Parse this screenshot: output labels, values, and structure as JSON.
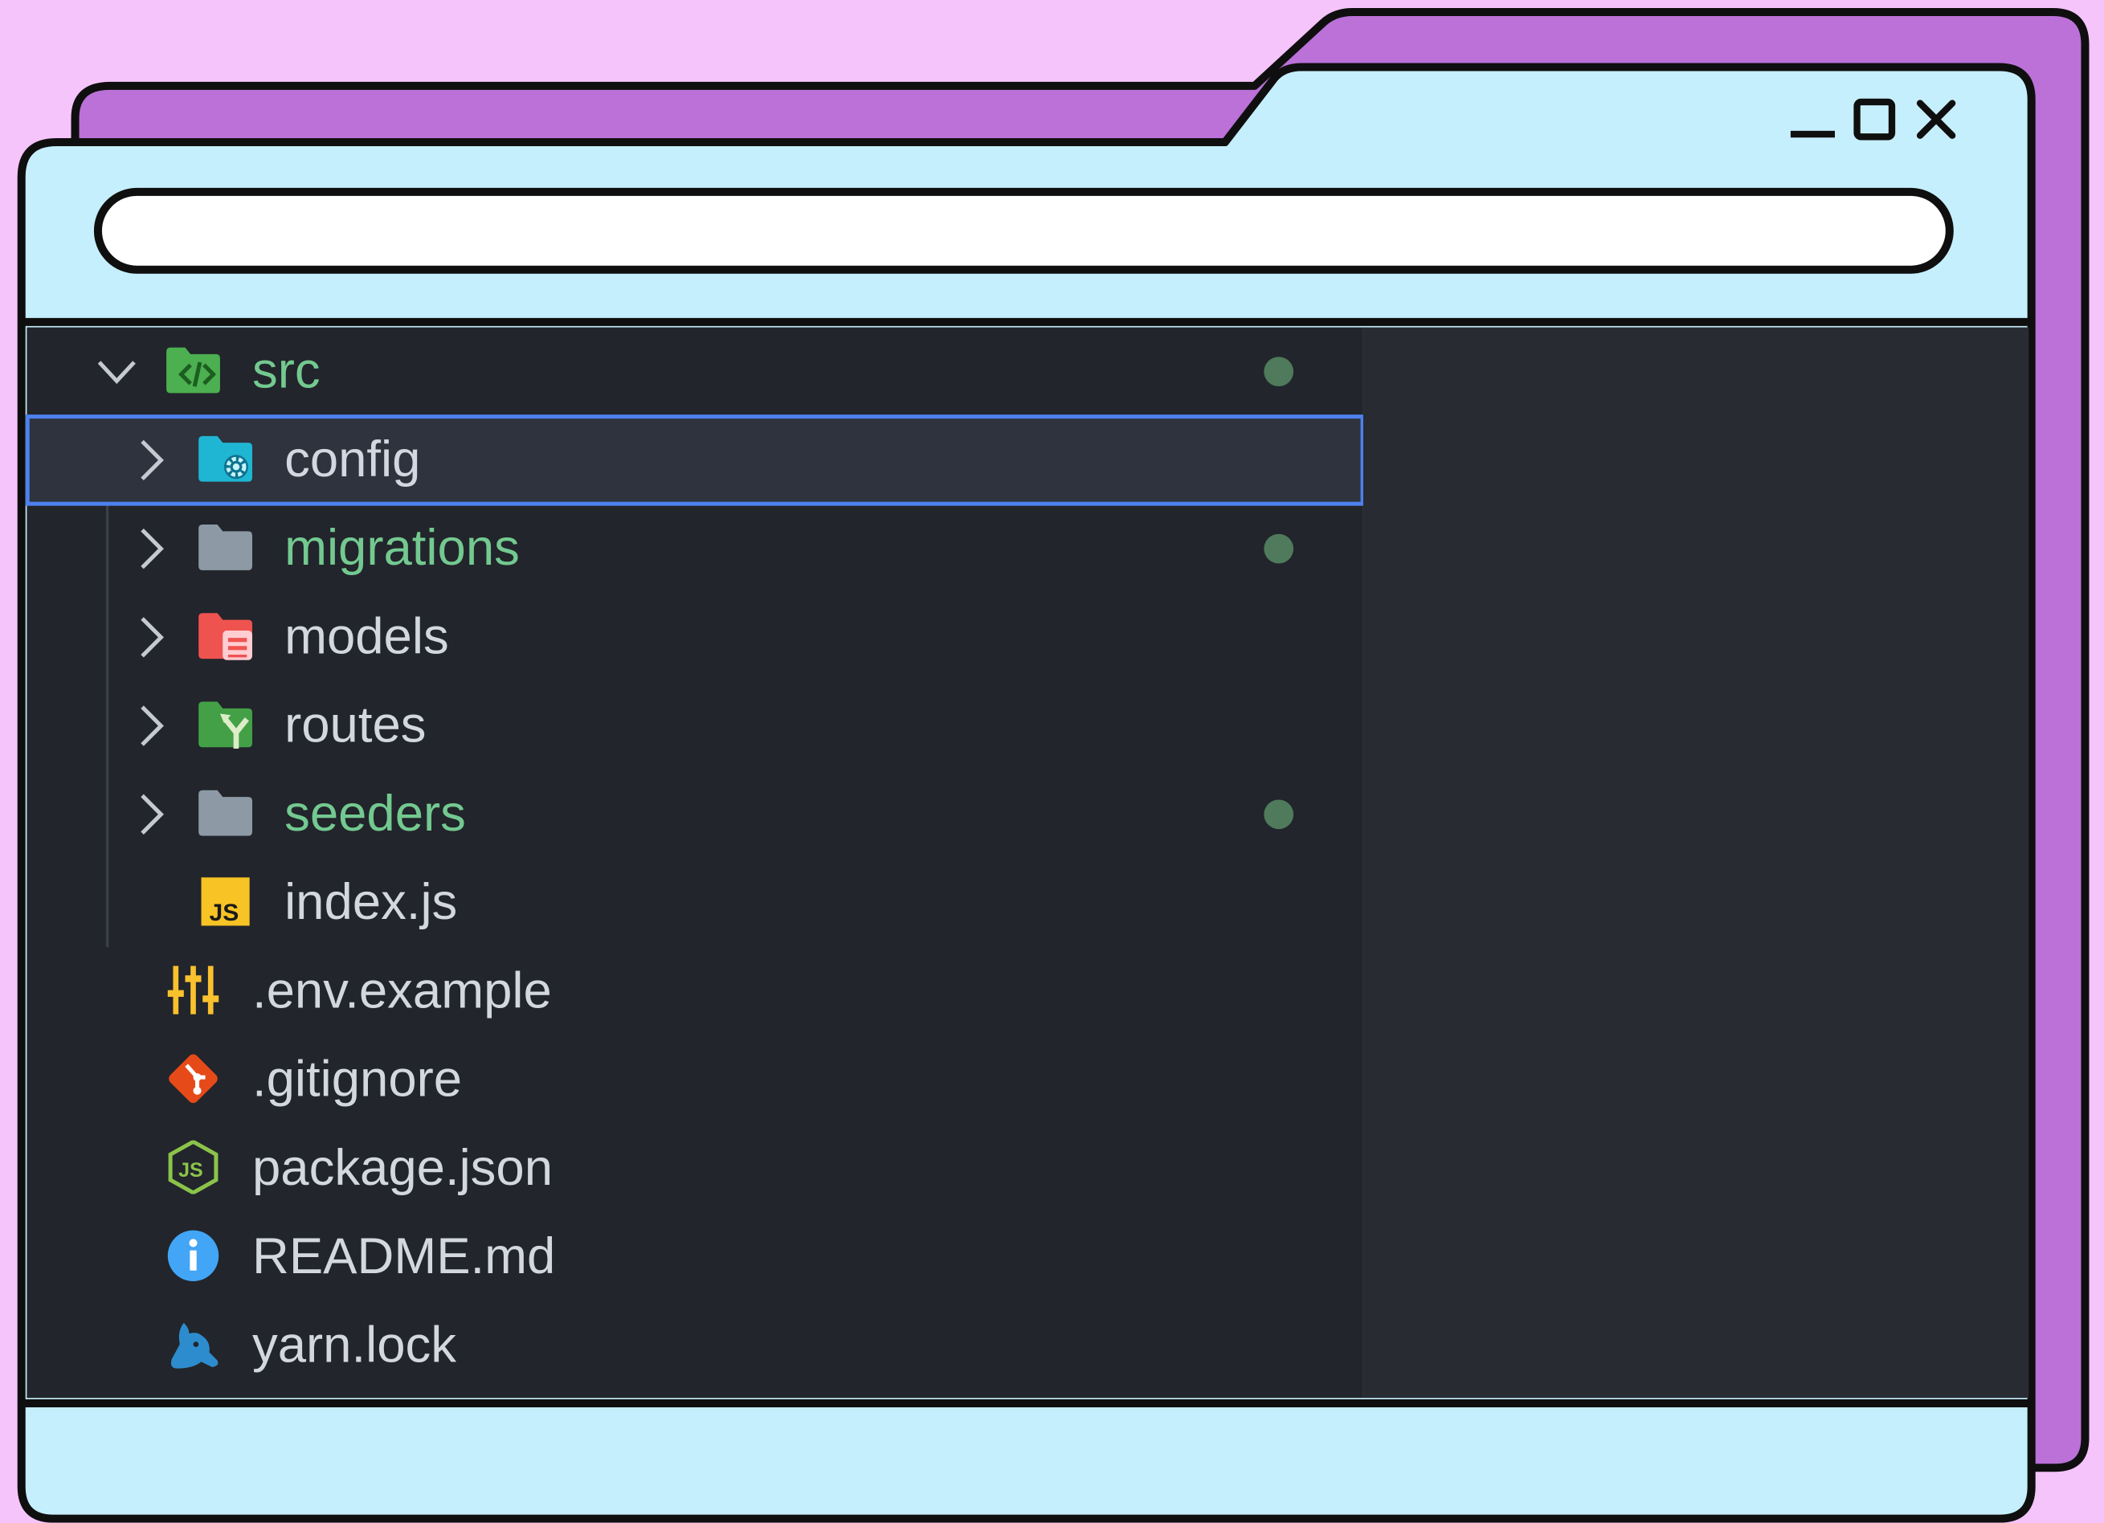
{
  "window": {
    "address_value": "",
    "controls": [
      "minimize-icon",
      "maximize-icon",
      "close-icon"
    ],
    "colors": {
      "backdrop": "#f5c4fb",
      "back_window": "#bb71d8",
      "window_body": "#c6effd",
      "outline": "#0f0f0f"
    }
  },
  "explorer": {
    "colors": {
      "panel": "#22252b",
      "side_panel": "#282b32",
      "text": "#d3d7df",
      "modified_text": "#73c990",
      "selection_border": "#4d82ee",
      "git_dot": "#4f7a5c"
    },
    "items": [
      {
        "label": "src",
        "icon": "folder-src-icon",
        "expanded": true,
        "modified": true,
        "selected": false
      },
      {
        "label": "config",
        "icon": "folder-config-icon",
        "expanded": false,
        "modified": false,
        "selected": true
      },
      {
        "label": "migrations",
        "icon": "folder-icon",
        "expanded": false,
        "modified": true,
        "selected": false
      },
      {
        "label": "models",
        "icon": "folder-database-icon",
        "expanded": false,
        "modified": false,
        "selected": false
      },
      {
        "label": "routes",
        "icon": "folder-routes-icon",
        "expanded": false,
        "modified": false,
        "selected": false
      },
      {
        "label": "seeders",
        "icon": "folder-icon",
        "expanded": false,
        "modified": true,
        "selected": false
      },
      {
        "label": "index.js",
        "icon": "javascript-file-icon",
        "expanded": false,
        "modified": false,
        "selected": false
      },
      {
        "label": ".env.example",
        "icon": "env-settings-icon",
        "expanded": false,
        "modified": false,
        "selected": false
      },
      {
        "label": ".gitignore",
        "icon": "git-icon",
        "expanded": false,
        "modified": false,
        "selected": false
      },
      {
        "label": "package.json",
        "icon": "nodejs-icon",
        "expanded": false,
        "modified": false,
        "selected": false
      },
      {
        "label": "README.md",
        "icon": "info-icon",
        "expanded": false,
        "modified": false,
        "selected": false
      },
      {
        "label": "yarn.lock",
        "icon": "yarn-icon",
        "expanded": false,
        "modified": false,
        "selected": false
      }
    ]
  }
}
